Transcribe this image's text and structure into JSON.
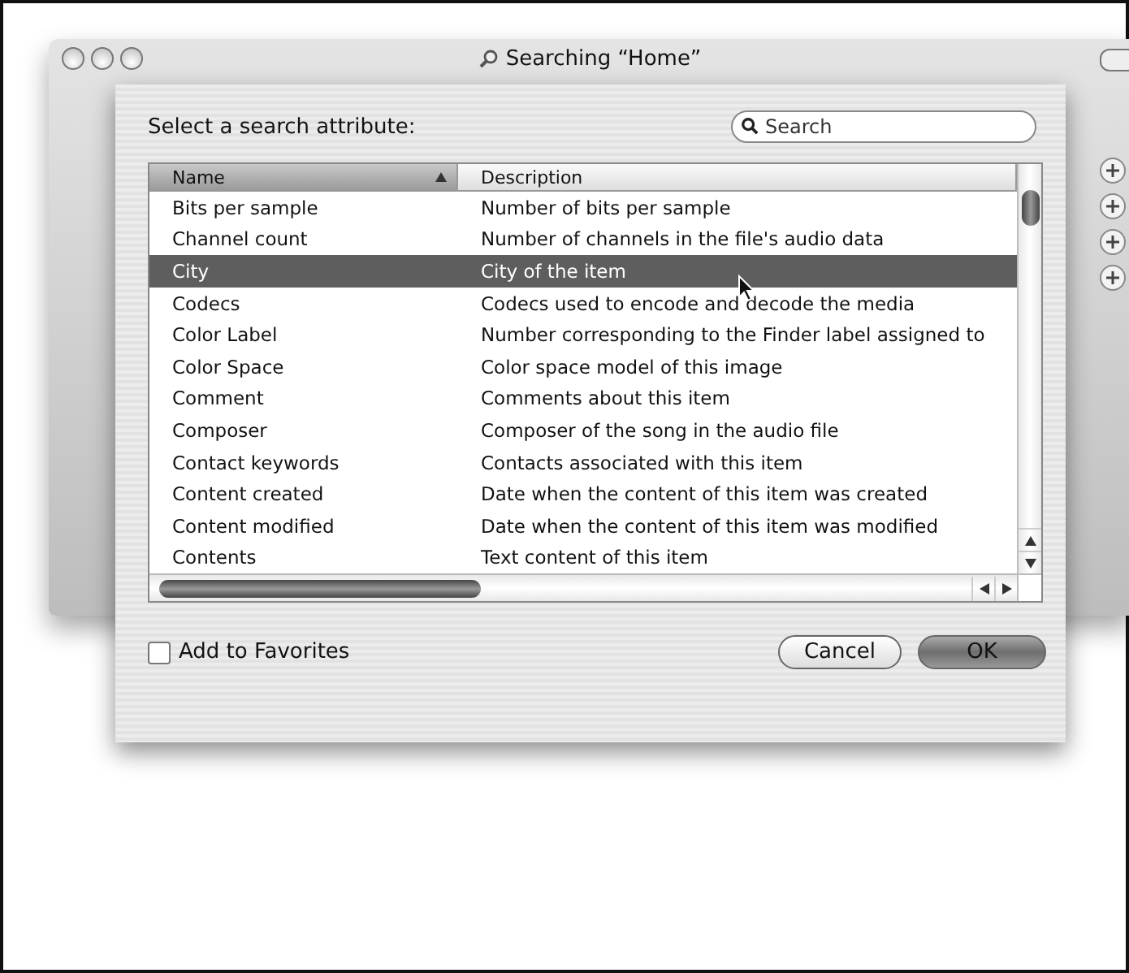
{
  "window": {
    "title": "Searching “Home”"
  },
  "sheet": {
    "prompt": "Select a search attribute:",
    "search": {
      "placeholder": "Search"
    },
    "table": {
      "columns": [
        {
          "label": "Name",
          "sorted": true
        },
        {
          "label": "Description",
          "sorted": false
        }
      ],
      "rows": [
        {
          "name": "Bits per sample",
          "description": "Number of bits per sample",
          "selected": false
        },
        {
          "name": "Channel count",
          "description": "Number of channels in the file's audio data",
          "selected": false
        },
        {
          "name": "City",
          "description": "City of the item",
          "selected": true
        },
        {
          "name": "Codecs",
          "description": "Codecs used to encode and decode the media",
          "selected": false
        },
        {
          "name": "Color Label",
          "description": "Number corresponding to the Finder label assigned to",
          "selected": false
        },
        {
          "name": "Color Space",
          "description": "Color space model of this image",
          "selected": false
        },
        {
          "name": "Comment",
          "description": "Comments about this item",
          "selected": false
        },
        {
          "name": "Composer",
          "description": "Composer of the song in the audio file",
          "selected": false
        },
        {
          "name": "Contact keywords",
          "description": "Contacts associated with this item",
          "selected": false
        },
        {
          "name": "Content created",
          "description": "Date when the content of this item was created",
          "selected": false
        },
        {
          "name": "Content modified",
          "description": "Date when the content of this item was modified",
          "selected": false
        },
        {
          "name": "Contents",
          "description": "Text content of this item",
          "selected": false
        }
      ]
    },
    "favorites": {
      "label": "Add to Favorites",
      "checked": false
    },
    "buttons": [
      {
        "label": "Cancel",
        "default": false
      },
      {
        "label": "OK",
        "default": true
      }
    ]
  }
}
